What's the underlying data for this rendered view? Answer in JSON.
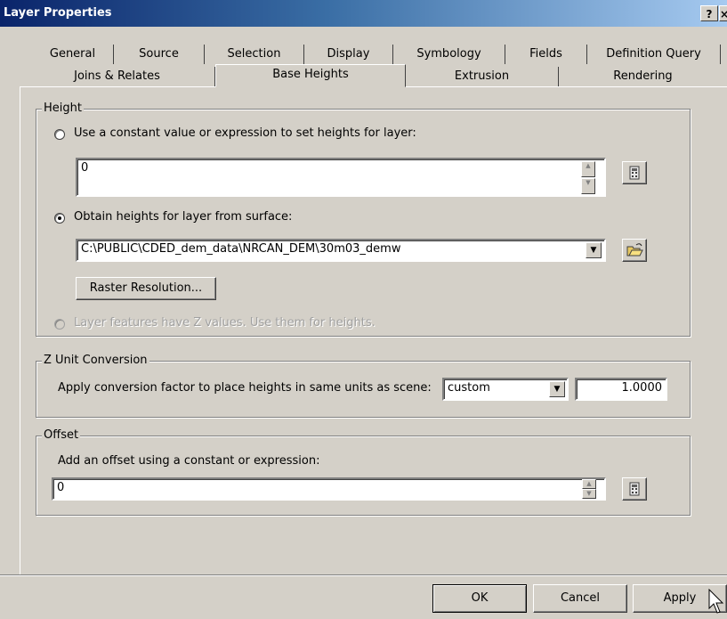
{
  "window": {
    "title": "Layer Properties",
    "help_label": "?",
    "close_label": "×"
  },
  "tabs_row1": [
    "General",
    "Source",
    "Selection",
    "Display",
    "Symbology",
    "Fields",
    "Definition Query"
  ],
  "tabs_row2": [
    "Joins & Relates",
    "Base Heights",
    "Extrusion",
    "Rendering"
  ],
  "active_tab": "Base Heights",
  "height": {
    "legend": "Height",
    "constant_label": "Use a constant value or expression to set heights for layer:",
    "constant_value": "0",
    "surface_label": "Obtain heights for layer from surface:",
    "surface_value": "C:\\PUBLIC\\CDED_dem_data\\NRCAN_DEM\\30m03_demw",
    "raster_button": "Raster Resolution...",
    "z_values_label": "Layer features have Z values.  Use them for heights.",
    "selected_option": "surface"
  },
  "z_unit": {
    "legend": "Z Unit Conversion",
    "label": "Apply conversion factor to place heights in same units as scene:",
    "unit_selected": "custom",
    "factor": "1.0000"
  },
  "offset": {
    "legend": "Offset",
    "label": "Add an offset using a constant or expression:",
    "value": "0"
  },
  "buttons": {
    "ok": "OK",
    "cancel": "Cancel",
    "apply": "Apply"
  },
  "icons": [
    "calculator-icon",
    "open-folder-icon",
    "dropdown-arrow-icon",
    "spin-up-icon",
    "spin-down-icon",
    "cursor-arrow-icon"
  ]
}
